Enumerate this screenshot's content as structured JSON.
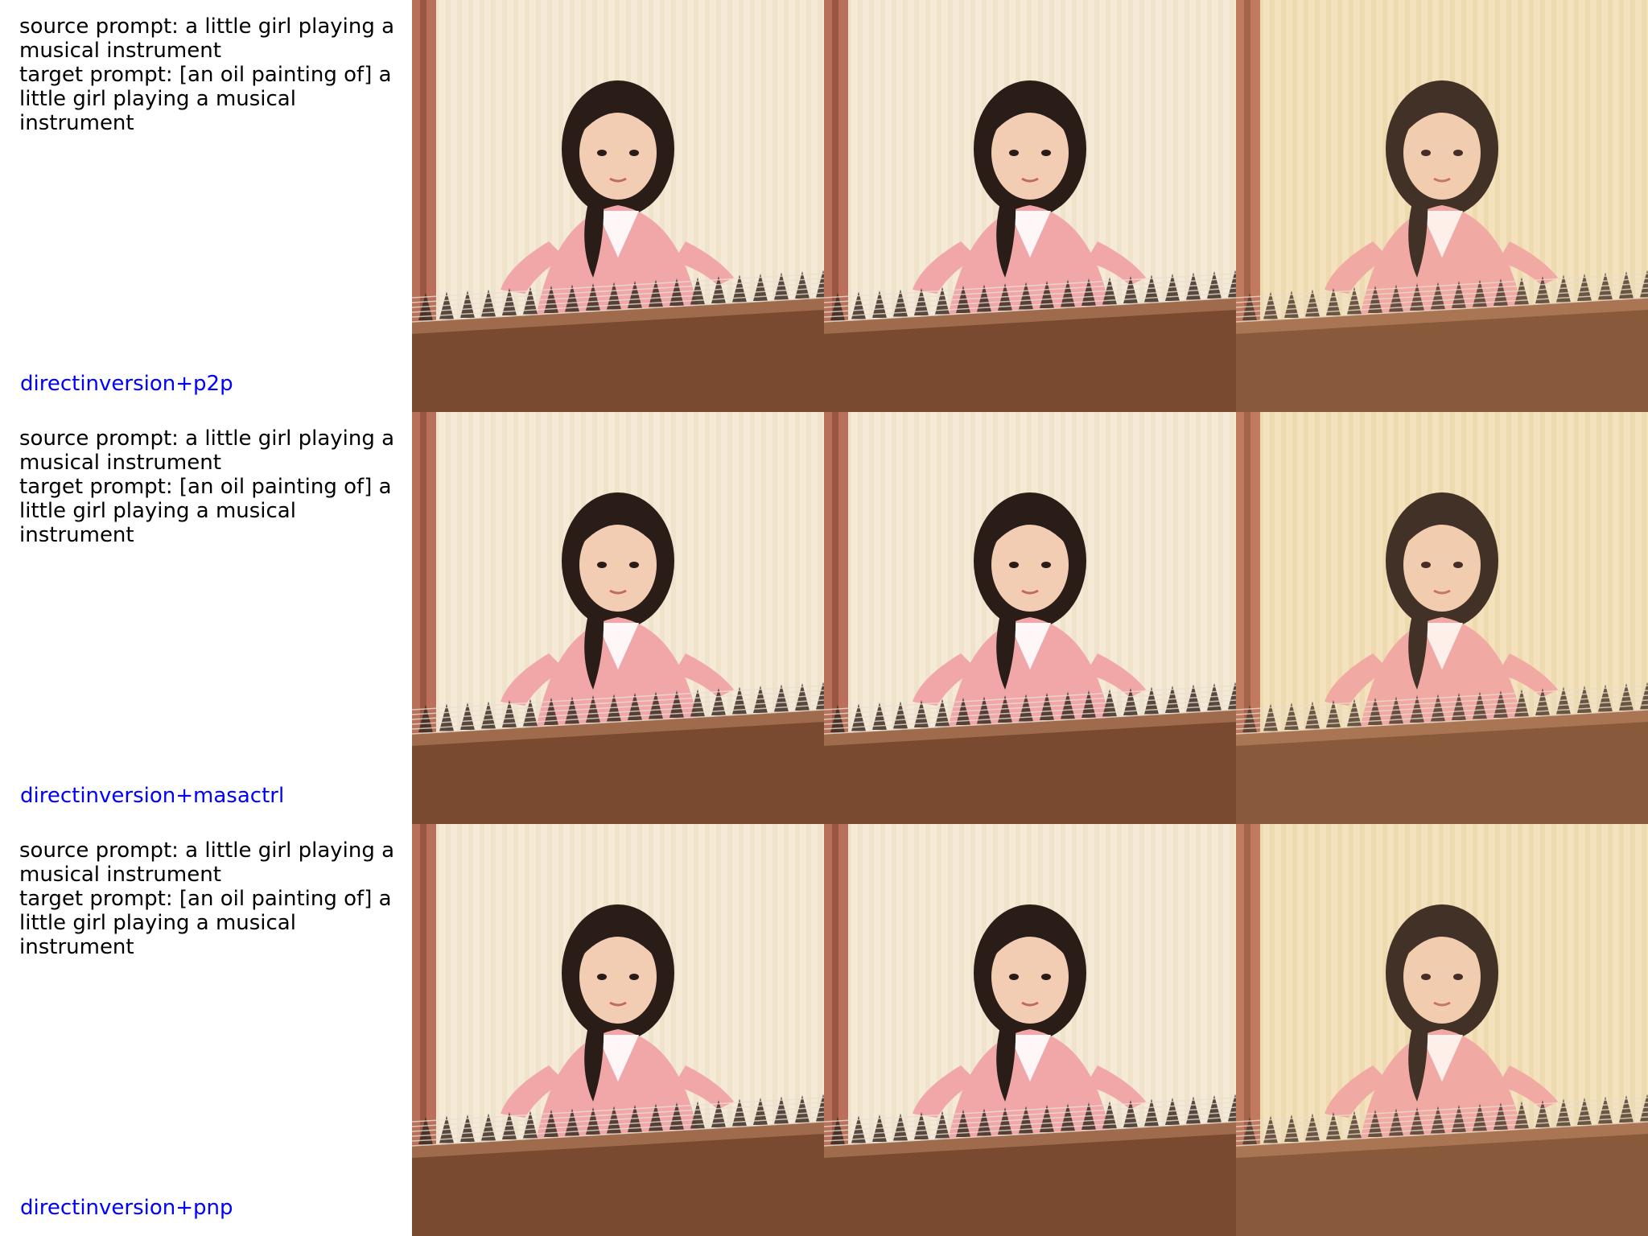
{
  "rows": [
    {
      "source_prompt": "source prompt: a little girl playing a musical instrument",
      "target_prompt": "target prompt: [an oil painting of] a little girl playing a musical instrument",
      "method": "directinversion+p2p",
      "images": [
        {
          "name": "source-image"
        },
        {
          "name": "reconstruction-image"
        },
        {
          "name": "edited-image"
        }
      ]
    },
    {
      "source_prompt": "source prompt: a little girl playing a musical instrument",
      "target_prompt": "target prompt: [an oil painting of] a little girl playing a musical instrument",
      "method": "directinversion+masactrl",
      "images": [
        {
          "name": "source-image"
        },
        {
          "name": "reconstruction-image"
        },
        {
          "name": "edited-image"
        }
      ]
    },
    {
      "source_prompt": "source prompt: a little girl playing a musical instrument",
      "target_prompt": "target prompt: [an oil painting of] a little girl playing a musical instrument",
      "method": "directinversion+pnp",
      "images": [
        {
          "name": "source-image"
        },
        {
          "name": "reconstruction-image"
        },
        {
          "name": "edited-image"
        }
      ]
    }
  ],
  "colors": {
    "method_label": "#0000ff",
    "curtain": "#f4ead6",
    "dress": "#f1a6a8",
    "hair": "#2a1d18",
    "wood": "#7a4a30"
  }
}
